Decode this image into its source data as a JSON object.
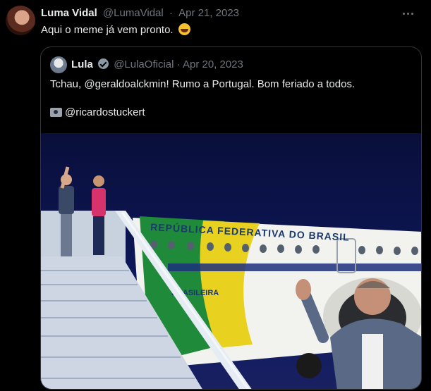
{
  "tweet": {
    "author_name": "Luma Vidal",
    "handle": "@LumaVidal",
    "date": "Apr 21, 2023",
    "text": "Aqui o meme já vem pronto."
  },
  "quoted": {
    "author_name": "Lula",
    "handle": "@LulaOficial",
    "date": "Apr 20, 2023",
    "text": "Tchau, @geraldoalckmin! Rumo a Portugal. Bom feriado a todos.",
    "credit": "@ricardostuckert"
  },
  "photo": {
    "plane_text": "REPÚBLICA FEDERATIVA DO BRASIL",
    "plane_text_small": "BRASILEIRA",
    "colors": {
      "sky": "#0c1552",
      "fuselage": "#f2f2ee",
      "stripe_green": "#1f8a3a",
      "stripe_yellow": "#e8d11f"
    }
  },
  "icons": {
    "more": "more-icon",
    "verified": "verified-icon",
    "emoji": "laughing-emoji-icon",
    "camera": "camera-icon"
  }
}
